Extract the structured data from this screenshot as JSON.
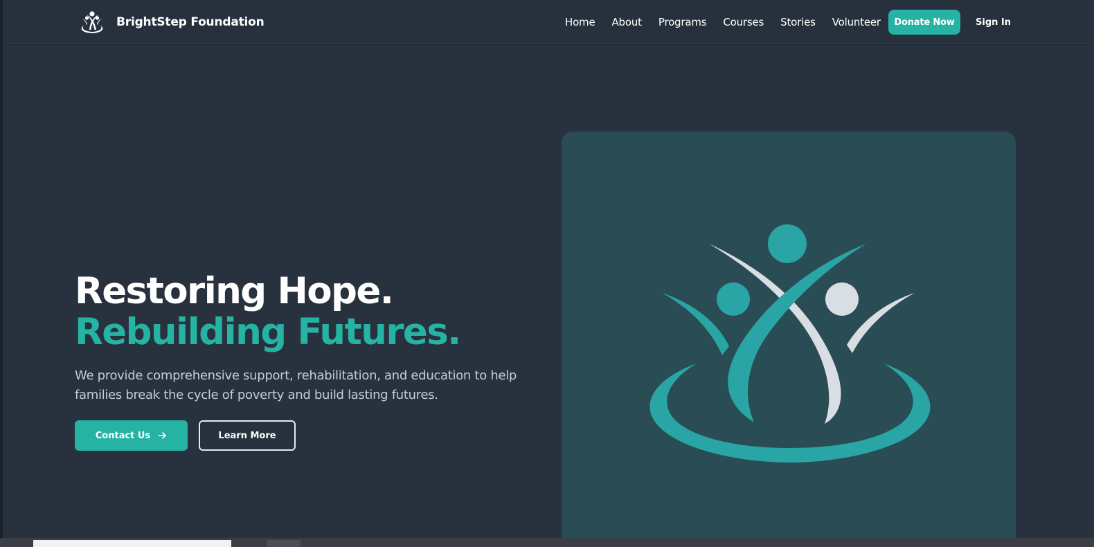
{
  "nav": {
    "brand_name": "BrightStep Foundation",
    "links": [
      "Home",
      "About",
      "Programs",
      "Courses",
      "Stories",
      "Volunteer"
    ],
    "donate_label": "Donate Now",
    "signin_label": "Sign In"
  },
  "hero": {
    "title_line1": "Restoring Hope.",
    "title_line2": "Rebuilding Futures.",
    "description": "We provide comprehensive support, rehabilitation, and education to help families break the cycle of poverty and build lasting futures.",
    "contact_label": "Contact Us",
    "learn_label": "Learn More"
  },
  "icons": {
    "brand_logo": "people-raising-arms-logo-icon",
    "contact_arrow": "arrow-right-icon",
    "hero_logo": "people-raising-arms-logo-icon"
  },
  "colors": {
    "accent": "#26b3a3",
    "background": "#28323f",
    "nav_background": "#27313d",
    "card_background": "#2a4c54",
    "logo_light": "#d9dee3"
  }
}
